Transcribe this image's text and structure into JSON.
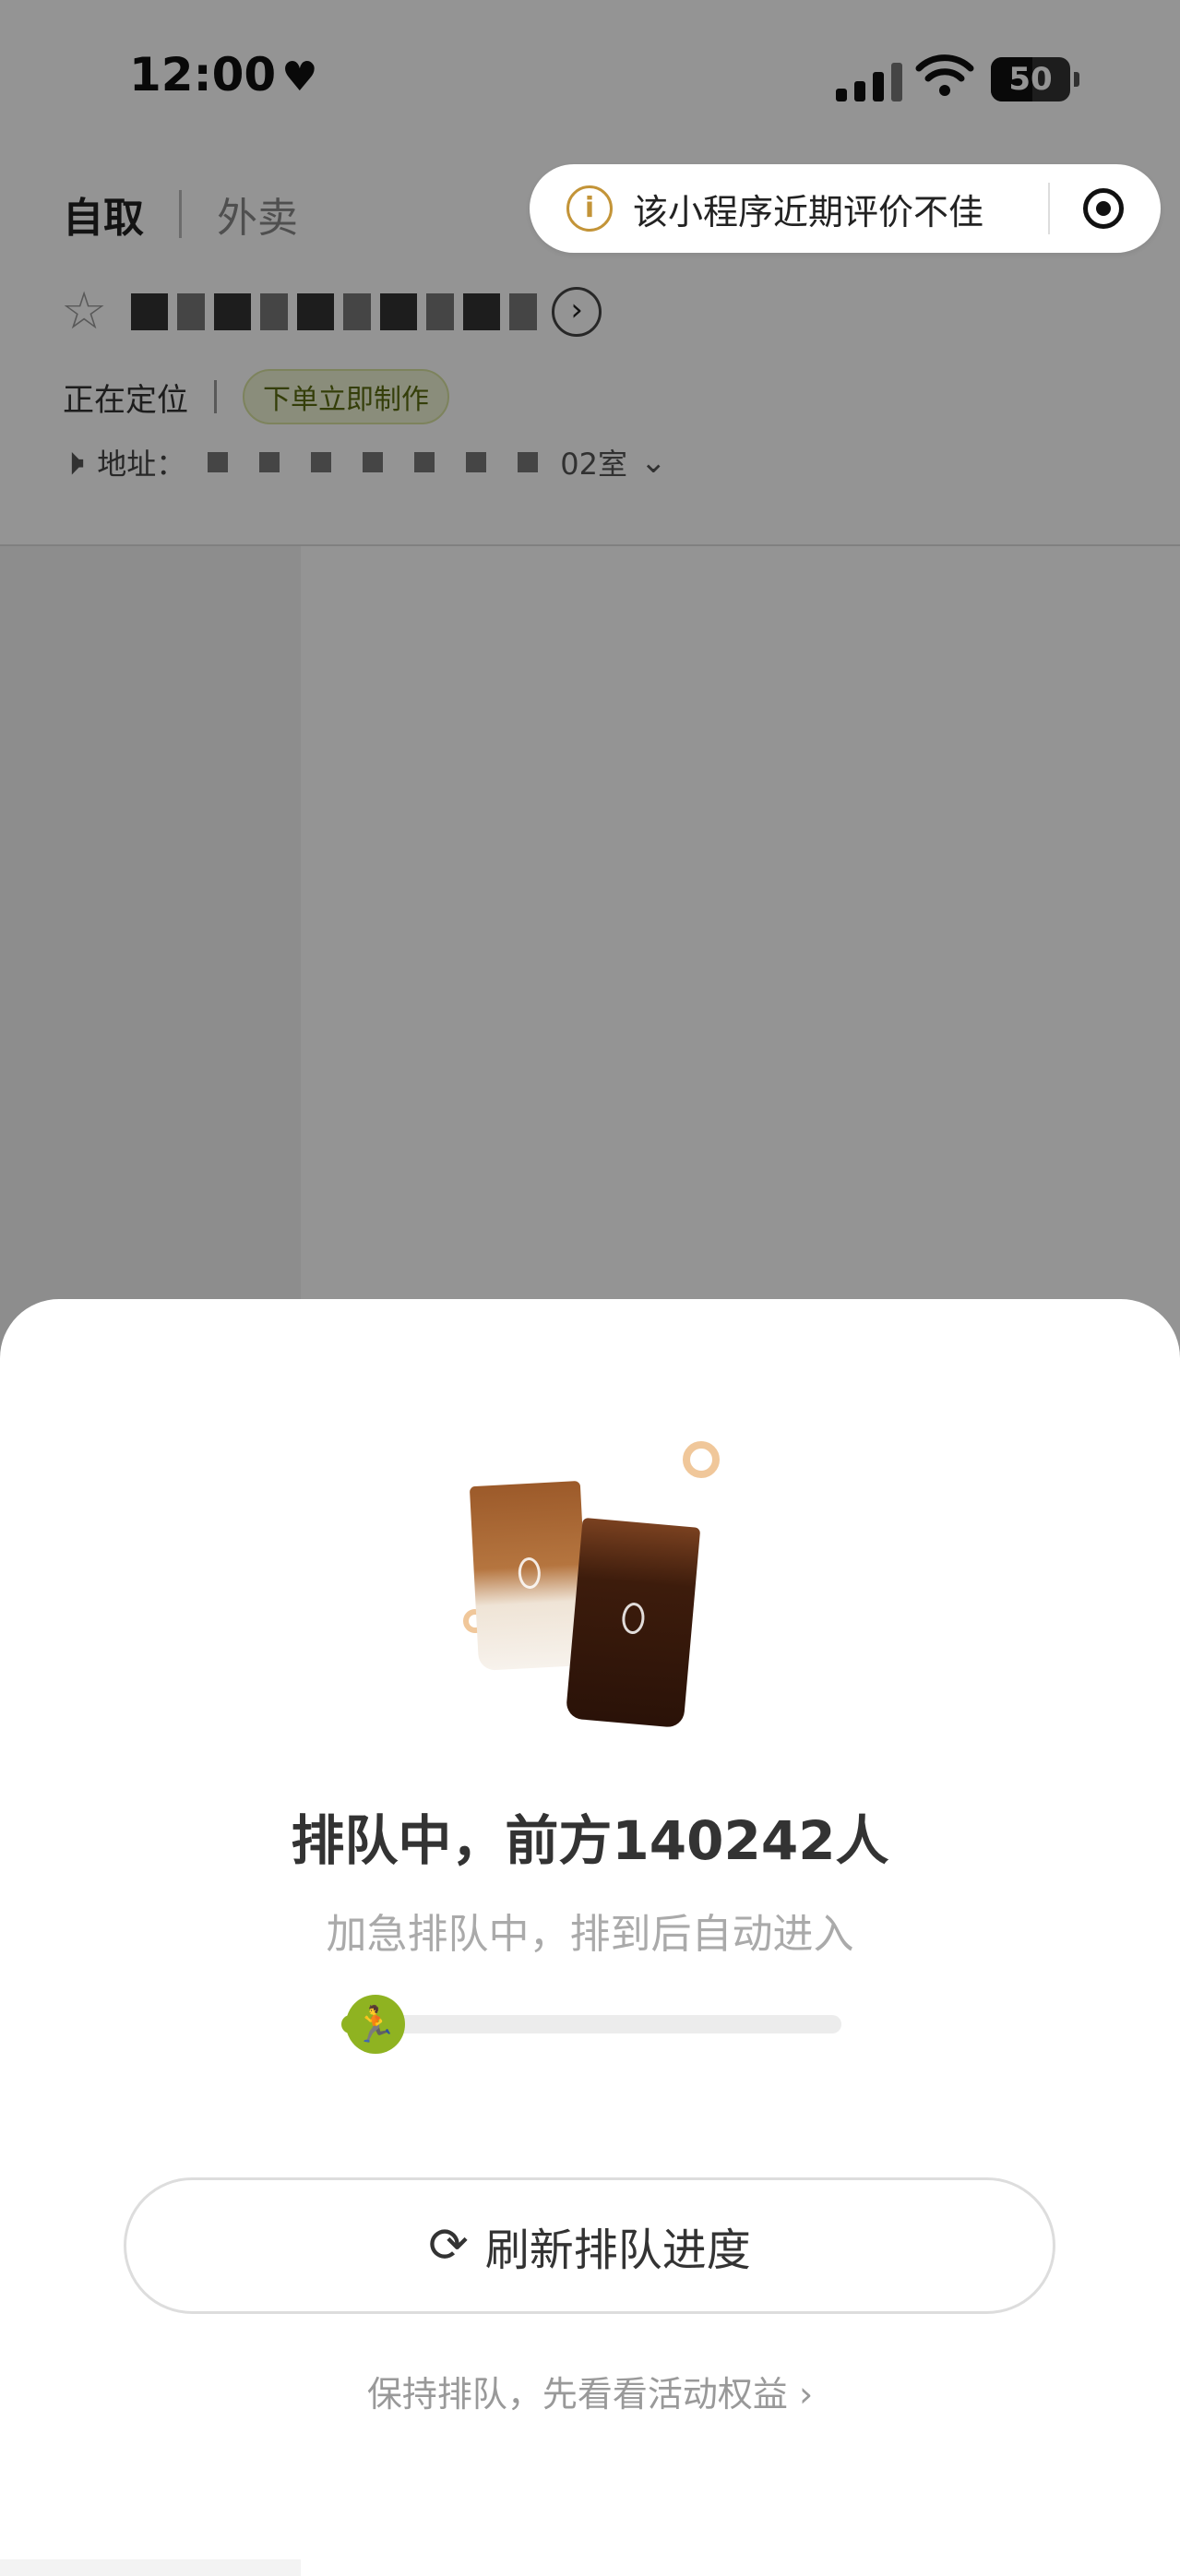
{
  "status_bar": {
    "time": "12:00",
    "battery": "50"
  },
  "header": {
    "tabs": [
      {
        "label": "自取"
      },
      {
        "label": "外卖"
      }
    ],
    "location_status": "正在定位",
    "tag": "下单立即制作",
    "address_label": "地址：",
    "address_tail": "02室"
  },
  "warning": {
    "text": "该小程序近期评价不佳"
  },
  "sheet": {
    "queue_title": "排队中，前方140242人",
    "queue_subtitle": "加急排队中，排到后自动进入",
    "progress_fraction": 0.12,
    "refresh_label": "刷新排队进度",
    "benefit_link": "保持排队，先看看活动权益 ›"
  },
  "colors": {
    "accent": "#8fb321",
    "warning": "#c39438"
  }
}
